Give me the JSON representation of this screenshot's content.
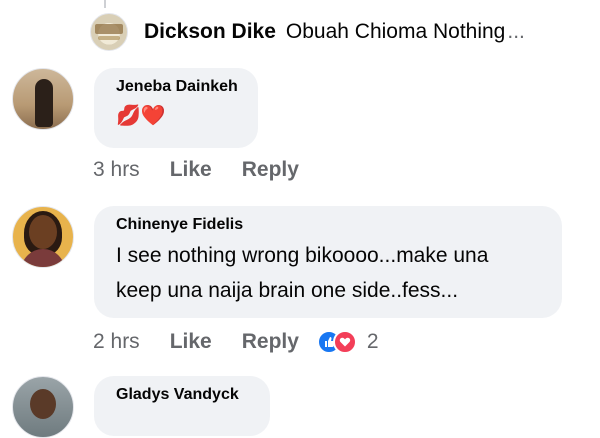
{
  "reply": {
    "author": "Dickson Dike",
    "text": "Obuah Chioma Nothing",
    "ellipsis": "..."
  },
  "comments": [
    {
      "author": "Jeneba Dainkeh",
      "emoji": "💋❤️",
      "time": "3 hrs",
      "like_label": "Like",
      "reply_label": "Reply"
    },
    {
      "author": "Chinenye Fidelis",
      "lines": [
        "I see nothing wrong bikoooo...make una",
        "keep una naija brain one side..fess..."
      ],
      "time": "2 hrs",
      "like_label": "Like",
      "reply_label": "Reply",
      "reaction_count": "2",
      "reactions": [
        "like-icon",
        "love-icon"
      ]
    },
    {
      "author": "Gladys Vandyck"
    }
  ],
  "colors": {
    "bubble": "#f0f2f5",
    "secondary_text": "#65676b",
    "like_blue": "#1877f2",
    "love_red": "#f33e58"
  }
}
